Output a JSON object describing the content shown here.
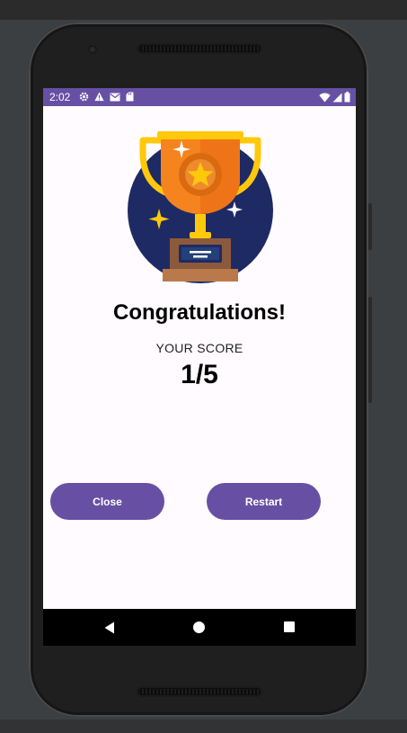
{
  "status_bar": {
    "time": "2:02",
    "left_icons": [
      "settings-icon",
      "warning-icon",
      "mail-icon",
      "sd-card-icon"
    ],
    "right_icons": [
      "wifi-icon",
      "signal-icon",
      "battery-icon"
    ]
  },
  "result": {
    "title": "Congratulations!",
    "score_label": "YOUR SCORE",
    "score_value": "1/5"
  },
  "buttons": {
    "close_label": "Close",
    "restart_label": "Restart"
  },
  "nav_bar": {
    "icons": [
      "back-icon",
      "home-icon",
      "recents-icon"
    ]
  },
  "colors": {
    "accent": "#6750a4",
    "screen_background": "#fffbfe",
    "trophy_circle": "#1e2a63",
    "trophy_orange": "#f5841f",
    "trophy_gold": "#ffc80a"
  }
}
